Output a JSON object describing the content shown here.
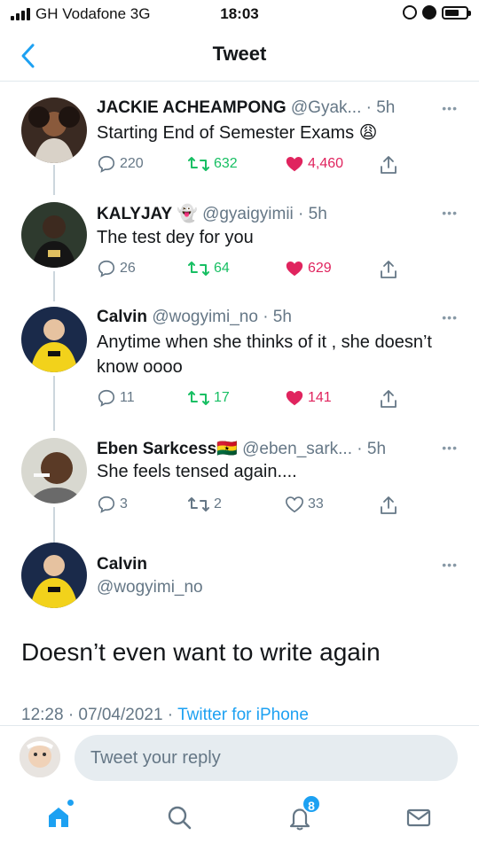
{
  "status": {
    "carrier": "GH Vodafone  3G",
    "time": "18:03"
  },
  "header": {
    "title": "Tweet"
  },
  "thread": [
    {
      "name": "JACKIE ACHEAMPONG",
      "meta": "@Gyak... · 5h",
      "text": "Starting End of Semester Exams 😩",
      "replies": "220",
      "retweets": "632",
      "likes": "4,460",
      "liked": true
    },
    {
      "name": "KALYJAY 👻",
      "meta": "@gyaigyimii · 5h",
      "text": "The test dey for you",
      "replies": "26",
      "retweets": "64",
      "likes": "629",
      "liked": true
    },
    {
      "name": "Calvin",
      "meta": "@wogyimi_no · 5h",
      "text": "Anytime when she thinks of it , she doesn’t know oooo",
      "replies": "11",
      "retweets": "17",
      "likes": "141",
      "liked": true
    },
    {
      "name": "Eben Sarkcess🇬🇭",
      "meta": "@eben_sark... · 5h",
      "text": "She feels tensed again....",
      "replies": "3",
      "retweets": "2",
      "likes": "33",
      "liked": false
    }
  ],
  "focused": {
    "name": "Calvin",
    "handle": "@wogyimi_no",
    "text": "Doesn’t even want to write again",
    "timestamp": "12:28 · 07/04/2021 · ",
    "source": "Twitter for iPhone"
  },
  "reply": {
    "placeholder": "Tweet your reply"
  },
  "nav": {
    "notifications_badge": "8"
  },
  "more_label": "•••",
  "colors": {
    "accent": "#1da1f2",
    "retweet": "#17bf63",
    "like": "#e0245e"
  }
}
